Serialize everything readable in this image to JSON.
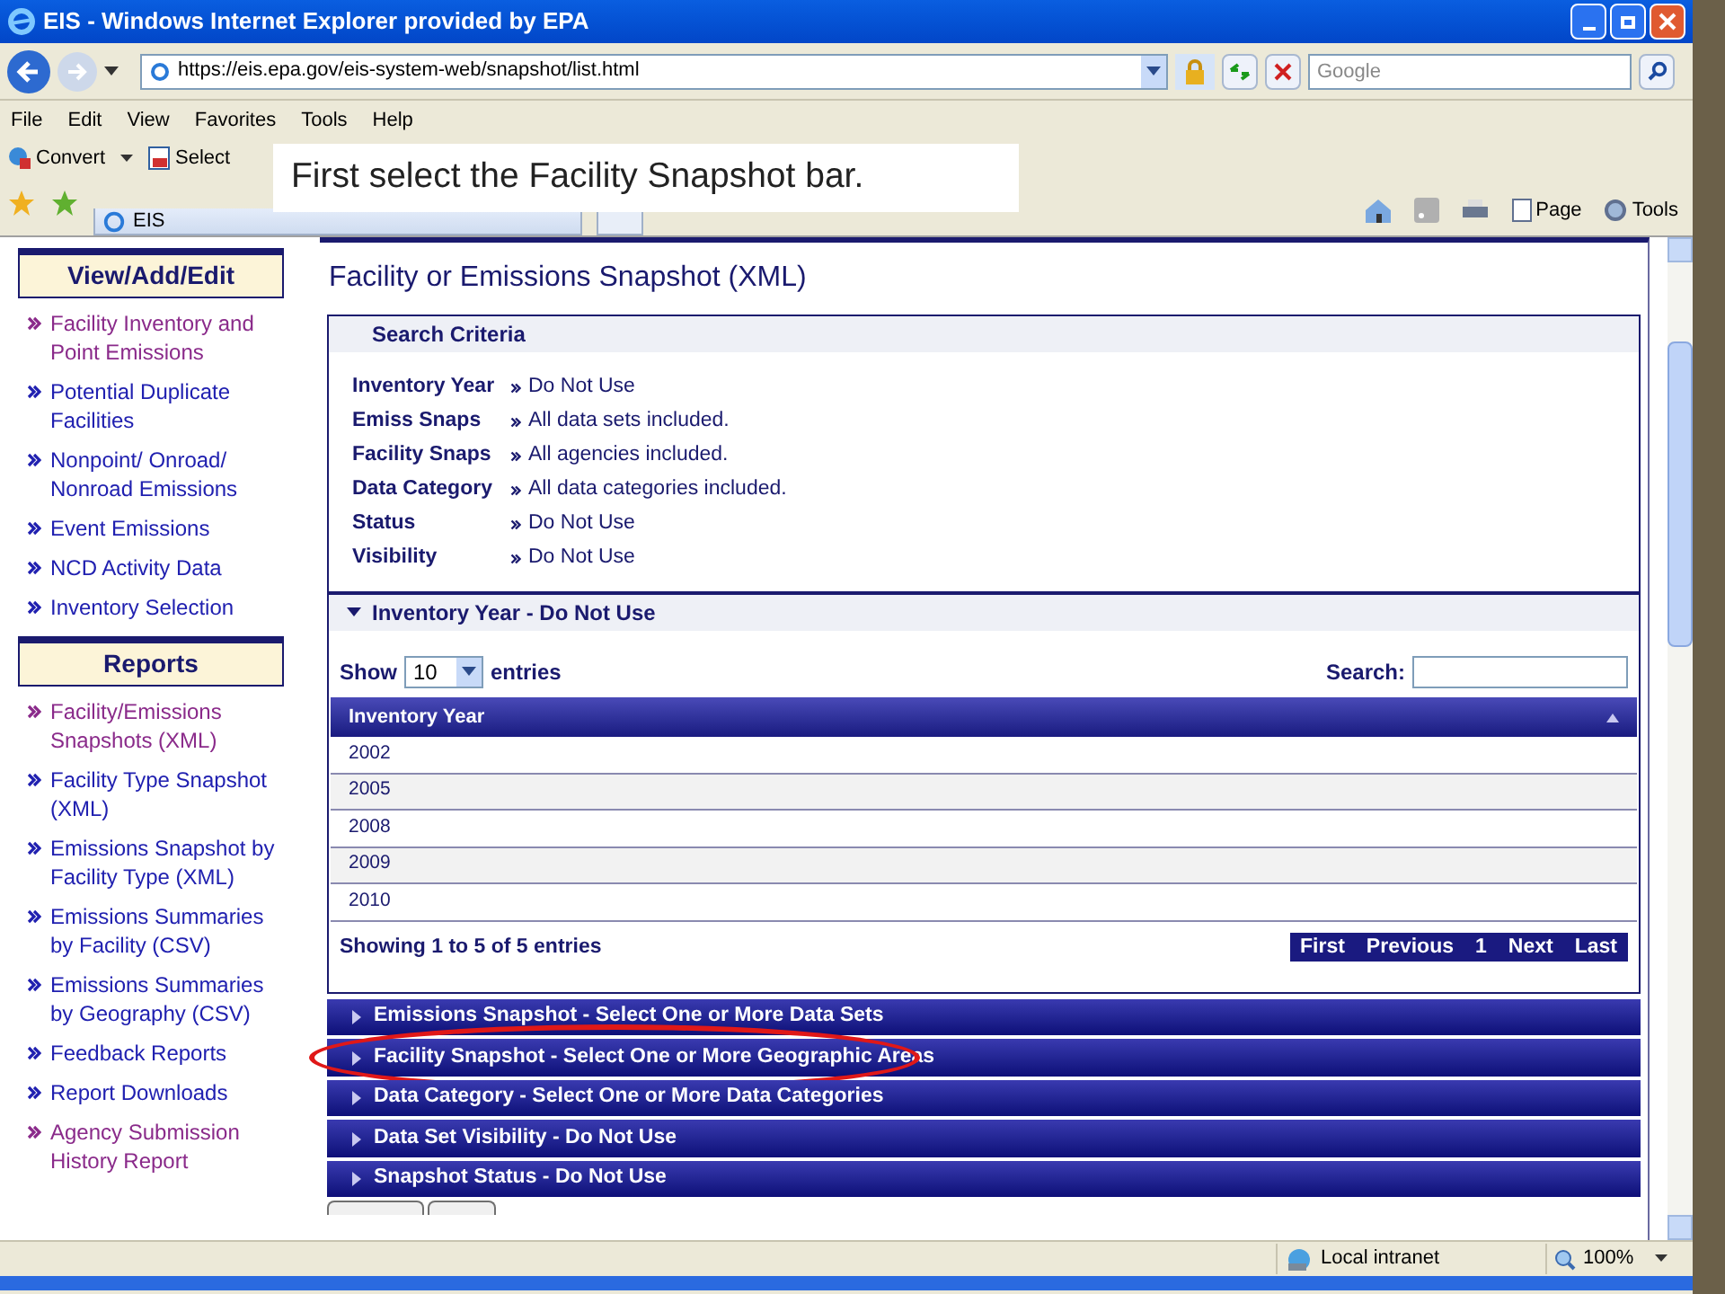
{
  "window": {
    "title": "EIS - Windows Internet Explorer provided by EPA"
  },
  "address_bar": {
    "url": "https://eis.epa.gov/eis-system-web/snapshot/list.html",
    "search_placeholder": "Google"
  },
  "menu": [
    "File",
    "Edit",
    "View",
    "Favorites",
    "Tools",
    "Help"
  ],
  "command_bar": [
    "Convert",
    "Select"
  ],
  "callout": "First select the Facility Snapshot bar.",
  "tab": {
    "label": "EIS"
  },
  "toolbar_right": [
    "Page",
    "Tools"
  ],
  "sidebar": [
    {
      "heading": "View/Add/Edit",
      "links": [
        {
          "label": "Facility Inventory and Point Emissions",
          "visited": true
        },
        {
          "label": "Potential Duplicate Facilities",
          "visited": false
        },
        {
          "label": "Nonpoint/ Onroad/ Nonroad Emissions",
          "visited": false
        },
        {
          "label": "Event Emissions",
          "visited": false
        },
        {
          "label": "NCD Activity Data",
          "visited": false
        },
        {
          "label": "Inventory Selection",
          "visited": false
        }
      ]
    },
    {
      "heading": "Reports",
      "links": [
        {
          "label": "Facility/Emissions Snapshots (XML)",
          "visited": true
        },
        {
          "label": "Facility Type Snapshot (XML)",
          "visited": false
        },
        {
          "label": "Emissions Snapshot by Facility Type (XML)",
          "visited": false
        },
        {
          "label": "Emissions Summaries by Facility (CSV)",
          "visited": false
        },
        {
          "label": "Emissions Summaries by Geography (CSV)",
          "visited": false
        },
        {
          "label": "Feedback Reports",
          "visited": false
        },
        {
          "label": "Report Downloads",
          "visited": false
        },
        {
          "label": "Agency Submission History Report",
          "visited": true
        }
      ]
    }
  ],
  "page_title": "Facility or Emissions Snapshot (XML)",
  "search_criteria": {
    "title": "Search Criteria",
    "rows": [
      {
        "label": "Inventory Year",
        "value": "Do Not Use"
      },
      {
        "label": "Emiss Snaps",
        "value": "All data sets included."
      },
      {
        "label": "Facility Snaps",
        "value": "All agencies included."
      },
      {
        "label": "Data Category",
        "value": "All data categories included."
      },
      {
        "label": "Status",
        "value": "Do Not Use"
      },
      {
        "label": "Visibility",
        "value": "Do Not Use"
      }
    ]
  },
  "sections": [
    {
      "title": "Inventory Year - Do Not Use",
      "expanded": true,
      "highlighted": false
    },
    {
      "title": "Emissions Snapshot - Select One or More Data Sets",
      "expanded": false,
      "highlighted": false
    },
    {
      "title": "Facility Snapshot - Select One or More Geographic Areas",
      "expanded": false,
      "highlighted": true
    },
    {
      "title": "Data Category - Select One or More Data Categories",
      "expanded": false,
      "highlighted": false
    },
    {
      "title": "Data Set Visibility - Do Not Use",
      "expanded": false,
      "highlighted": false
    },
    {
      "title": "Snapshot Status - Do Not Use",
      "expanded": false,
      "highlighted": false
    }
  ],
  "table": {
    "show_label": "Show",
    "page_size": "10",
    "entries_label": "entries",
    "search_label": "Search:",
    "column": "Inventory Year",
    "rows": [
      "2002",
      "2005",
      "2008",
      "2009",
      "2010"
    ],
    "info": "Showing **1** to **5** of **5** entries",
    "pager": [
      "First",
      "Previous",
      "1",
      "Next",
      "Last"
    ]
  },
  "status_bar": {
    "zone": "Local intranet",
    "zoom": "100%"
  }
}
